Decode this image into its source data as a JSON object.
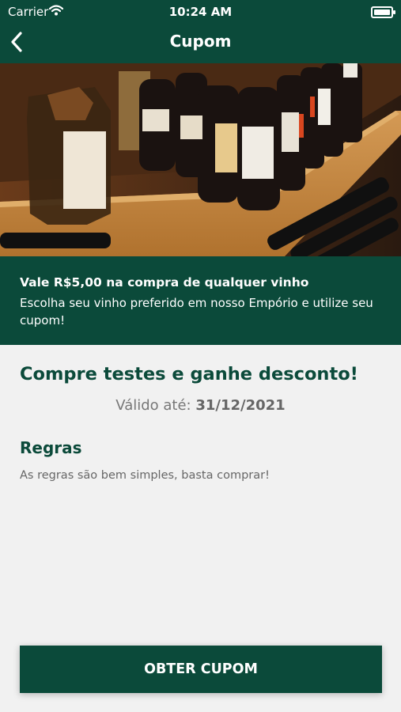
{
  "status_bar": {
    "carrier": "Carrier",
    "time": "10:24 AM"
  },
  "nav": {
    "title": "Cupom"
  },
  "coupon": {
    "banner_title": "Vale R$5,00 na compra de qualquer vinho",
    "banner_description": "Escolha seu vinho preferido em nosso Empório e utilize seu cupom!",
    "headline": "Compre testes e ganhe desconto!",
    "valid_label": "Válido até:",
    "valid_date": "31/12/2021"
  },
  "rules": {
    "title": "Regras",
    "text": "As regras são bem simples, basta comprar!"
  },
  "cta": {
    "label": "OBTER CUPOM"
  },
  "colors": {
    "primary": "#0b4a3a",
    "background": "#f1f1f1"
  }
}
